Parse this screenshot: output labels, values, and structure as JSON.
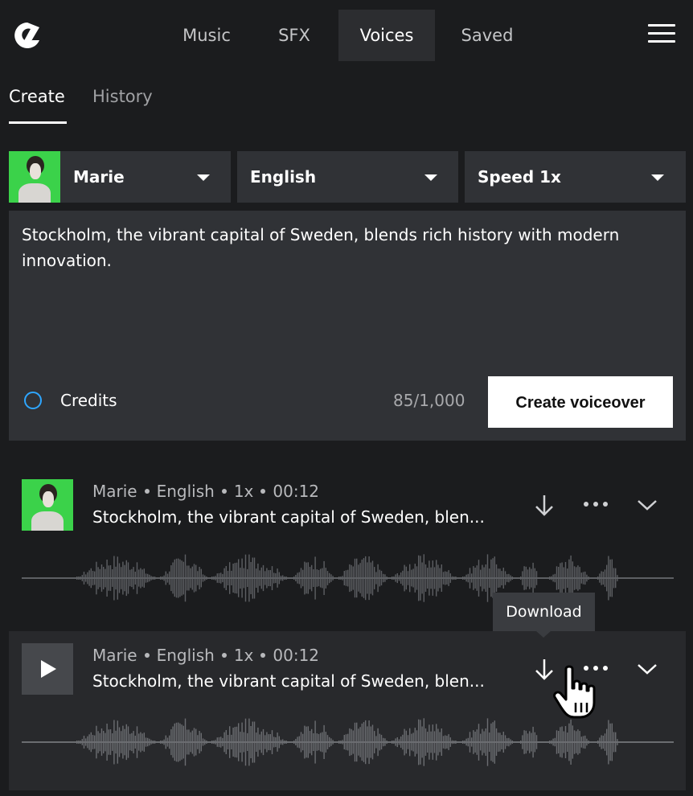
{
  "nav": {
    "items": [
      {
        "label": "Music"
      },
      {
        "label": "SFX"
      },
      {
        "label": "Voices"
      },
      {
        "label": "Saved"
      }
    ],
    "active": "Voices"
  },
  "tabs": {
    "items": [
      {
        "label": "Create"
      },
      {
        "label": "History"
      }
    ],
    "active": "Create"
  },
  "selectors": {
    "voice": "Marie",
    "language": "English",
    "speed": "Speed 1x"
  },
  "editor": {
    "text": "Stockholm, the vibrant capital of Sweden, blends rich history with modern innovation.",
    "credits_label": "Credits",
    "counter": "85/1,000",
    "create_button": "Create voiceover"
  },
  "history": [
    {
      "voice": "Marie",
      "language": "English",
      "speed": "1x",
      "duration": "00:12",
      "title": "Stockholm, the vibrant capital of Sweden, blen..."
    },
    {
      "voice": "Marie",
      "language": "English",
      "speed": "1x",
      "duration": "00:12",
      "title": "Stockholm, the vibrant capital of Sweden, blen..."
    }
  ],
  "tooltip": "Download",
  "colors": {
    "background": "#1b1c1e",
    "panel": "#303236",
    "accent": "#2ea6ff",
    "avatar_bg": "#3bd24a"
  },
  "icons": [
    "logo-icon",
    "hamburger-menu-icon",
    "chevron-down-icon",
    "download-icon",
    "more-icon",
    "play-icon",
    "pointer-hand-cursor-icon"
  ]
}
